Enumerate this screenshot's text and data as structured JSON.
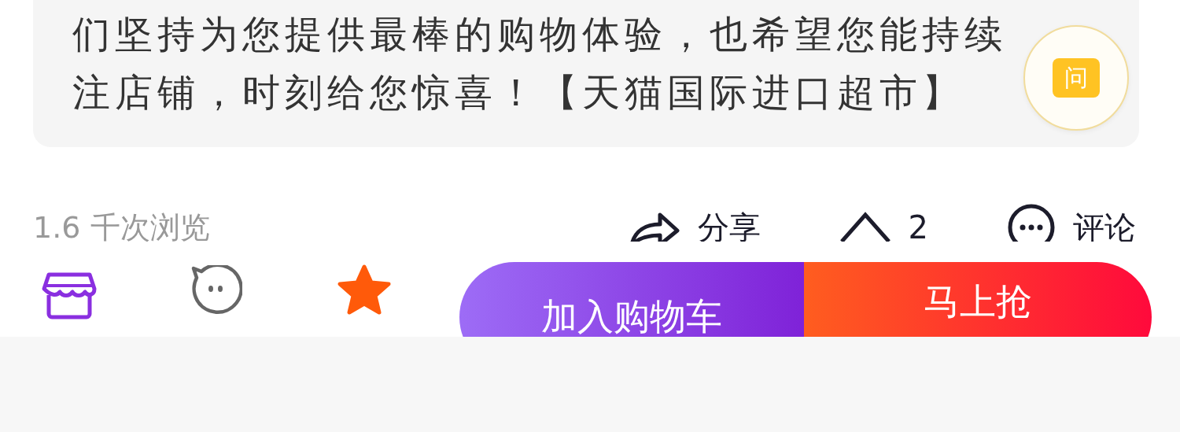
{
  "description": {
    "lines": [
      "们坚持为您提供最棒的购物体验，也希望您能持续",
      "注店铺，时刻给您惊喜！【天猫国际进口超市】"
    ]
  },
  "ask_button": {
    "label": "问"
  },
  "stats": {
    "views": "1.6 千次浏览",
    "actions": [
      {
        "kind": "share",
        "label": "分享"
      },
      {
        "kind": "like",
        "label": "2"
      },
      {
        "kind": "comment",
        "label": "评论"
      }
    ]
  },
  "bottom_bar": {
    "favorite": {
      "on": true
    },
    "add_to_cart": "加入购物车",
    "buy_now": "马上抢"
  }
}
